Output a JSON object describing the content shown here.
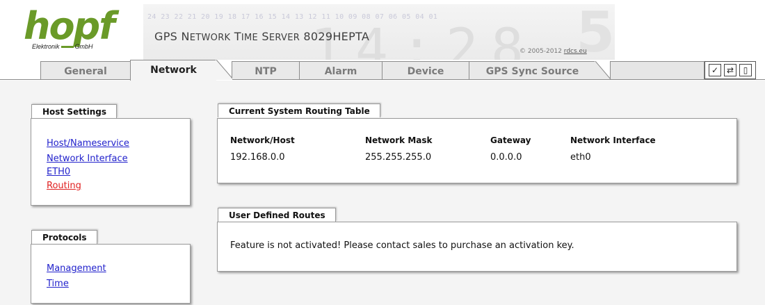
{
  "header": {
    "logo_word": "hopf",
    "logo_left": "Elektronik",
    "logo_right": "GmbH",
    "banner_digits": "24 23 22 21 20 19 18 17 16 15 14 13 12 11 10 09 08 07 06 05 04 01",
    "title_first": "GPS N",
    "title_rest_1": "ETWORK",
    "title_space_1": " T",
    "title_rest_2": "IME",
    "title_space_2": " S",
    "title_rest_3": "ERVER",
    "title_model": " 8029HEPTA",
    "copyright_prefix": "© 2005-2012 ",
    "copyright_link": "rdcs.eu"
  },
  "tabs": [
    {
      "label": "General"
    },
    {
      "label": "Network"
    },
    {
      "label": "NTP"
    },
    {
      "label": "Alarm"
    },
    {
      "label": "Device"
    },
    {
      "label": "GPS Sync Source"
    }
  ],
  "toolbar": {
    "apply_icon": "checkmark-icon",
    "reload_icon": "reload-icon",
    "save_icon": "save-icon"
  },
  "sidebar": {
    "host_settings": {
      "title": "Host Settings",
      "links": [
        "Host/Nameservice",
        "Network Interface",
        "ETH0",
        "Routing"
      ]
    },
    "protocols": {
      "title": "Protocols",
      "links": [
        "Management",
        "Time"
      ]
    }
  },
  "routing_table": {
    "title": "Current System Routing Table",
    "columns": [
      "Network/Host",
      "Network Mask",
      "Gateway",
      "Network Interface"
    ],
    "rows": [
      [
        "192.168.0.0",
        "255.255.255.0",
        "0.0.0.0",
        "eth0"
      ]
    ]
  },
  "user_routes": {
    "title": "User Defined Routes",
    "message": "Feature is not activated! Please contact sales to purchase an activation key."
  },
  "colors": {
    "logo_green": "#6a9a28",
    "link": "#2222cc",
    "link_current": "#e02020"
  }
}
